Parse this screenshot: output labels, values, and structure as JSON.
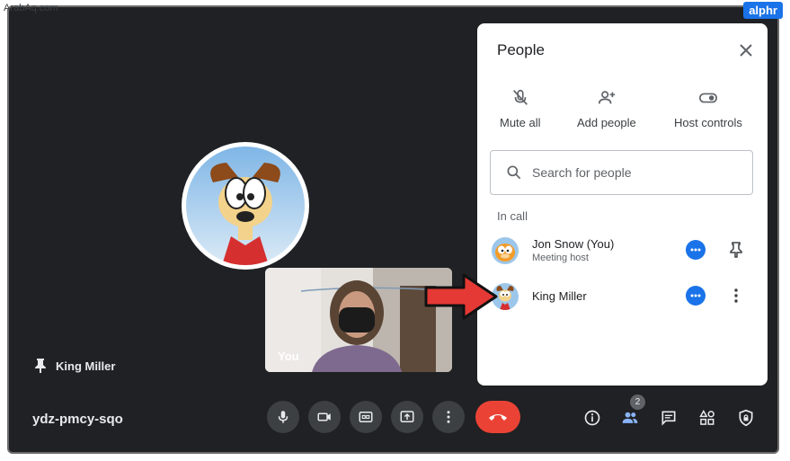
{
  "watermark": {
    "left": "ArabAq.com",
    "right": "alphr"
  },
  "main": {
    "pinned_participant": "King Miller",
    "self_label": "You",
    "meeting_code": "ydz-pmcy-sqo"
  },
  "toolbar": {
    "people_count": "2"
  },
  "panel": {
    "title": "People",
    "actions": [
      {
        "label": "Mute all",
        "icon": "mic-off-icon"
      },
      {
        "label": "Add people",
        "icon": "add-person-icon"
      },
      {
        "label": "Host controls",
        "icon": "toggle-icon"
      }
    ],
    "search_placeholder": "Search for people",
    "section": "In call",
    "participants": [
      {
        "name": "Jon Snow (You)",
        "role": "Meeting host"
      },
      {
        "name": "King Miller",
        "role": ""
      }
    ]
  },
  "colors": {
    "background": "#202124",
    "accent": "#1a73e8",
    "end_call": "#ea4335",
    "arrow": "#e53935"
  }
}
